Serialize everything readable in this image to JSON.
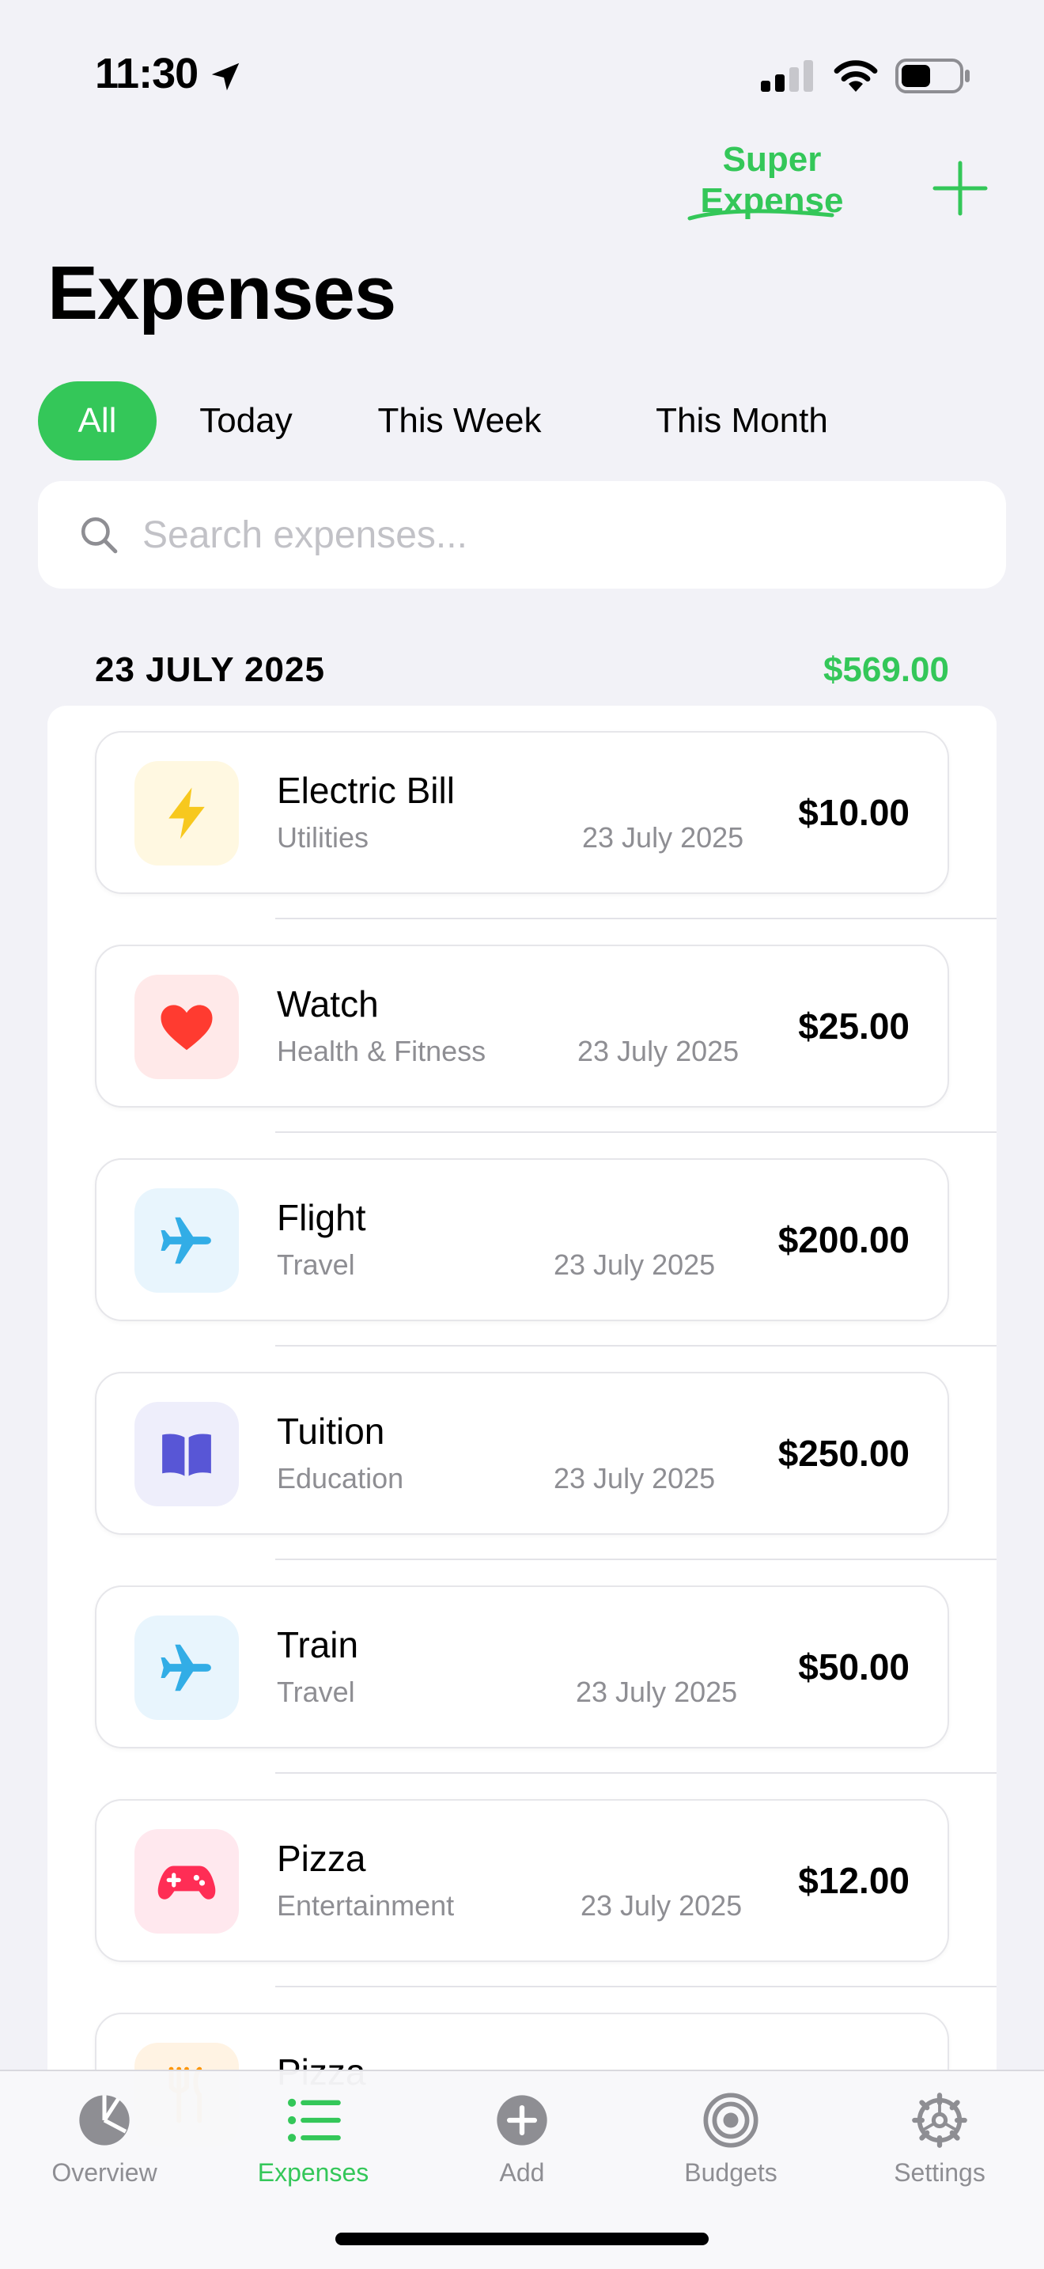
{
  "status_bar": {
    "time": "11:30"
  },
  "header": {
    "brand_line1": "Super",
    "brand_line2": "Expense",
    "title": "Expenses"
  },
  "filters": {
    "all": "All",
    "today": "Today",
    "this_week": "This Week",
    "this_month": "This Month",
    "active": "All"
  },
  "search": {
    "placeholder": "Search expenses...",
    "value": ""
  },
  "section": {
    "date": "23 JULY 2025",
    "total": "$569.00"
  },
  "expenses": [
    {
      "name": "Electric Bill",
      "category": "Utilities",
      "date": "23 July 2025",
      "amount": "$10.00",
      "icon": "bolt-icon",
      "icon_color": "#f7c81e",
      "icon_bg": "#fff8e1"
    },
    {
      "name": "Watch",
      "category": "Health & Fitness",
      "date": "23 July 2025",
      "amount": "$25.00",
      "icon": "heart-icon",
      "icon_color": "#ff3b30",
      "icon_bg": "#ffe9e9"
    },
    {
      "name": "Flight",
      "category": "Travel",
      "date": "23 July 2025",
      "amount": "$200.00",
      "icon": "airplane-icon",
      "icon_color": "#32ade6",
      "icon_bg": "#e8f5fd"
    },
    {
      "name": "Tuition",
      "category": "Education",
      "date": "23 July 2025",
      "amount": "$250.00",
      "icon": "book-icon",
      "icon_color": "#5856d6",
      "icon_bg": "#eeeefb"
    },
    {
      "name": "Train",
      "category": "Travel",
      "date": "23 July 2025",
      "amount": "$50.00",
      "icon": "airplane-icon",
      "icon_color": "#32ade6",
      "icon_bg": "#e8f5fd"
    },
    {
      "name": "Pizza",
      "category": "Entertainment",
      "date": "23 July 2025",
      "amount": "$12.00",
      "icon": "gamecontroller-icon",
      "icon_color": "#ff2d55",
      "icon_bg": "#ffe8ee"
    },
    {
      "name": "Pizza",
      "category": "",
      "date": "",
      "amount": "",
      "icon": "fork-knife-icon",
      "icon_color": "#ff9500",
      "icon_bg": "#fff3e3"
    }
  ],
  "tab_bar": {
    "overview": "Overview",
    "expenses": "Expenses",
    "add": "Add",
    "budgets": "Budgets",
    "settings": "Settings",
    "active": "Expenses"
  },
  "colors": {
    "accent": "#34c759",
    "background": "#f2f2f7",
    "secondary_text": "#8e8e93"
  }
}
